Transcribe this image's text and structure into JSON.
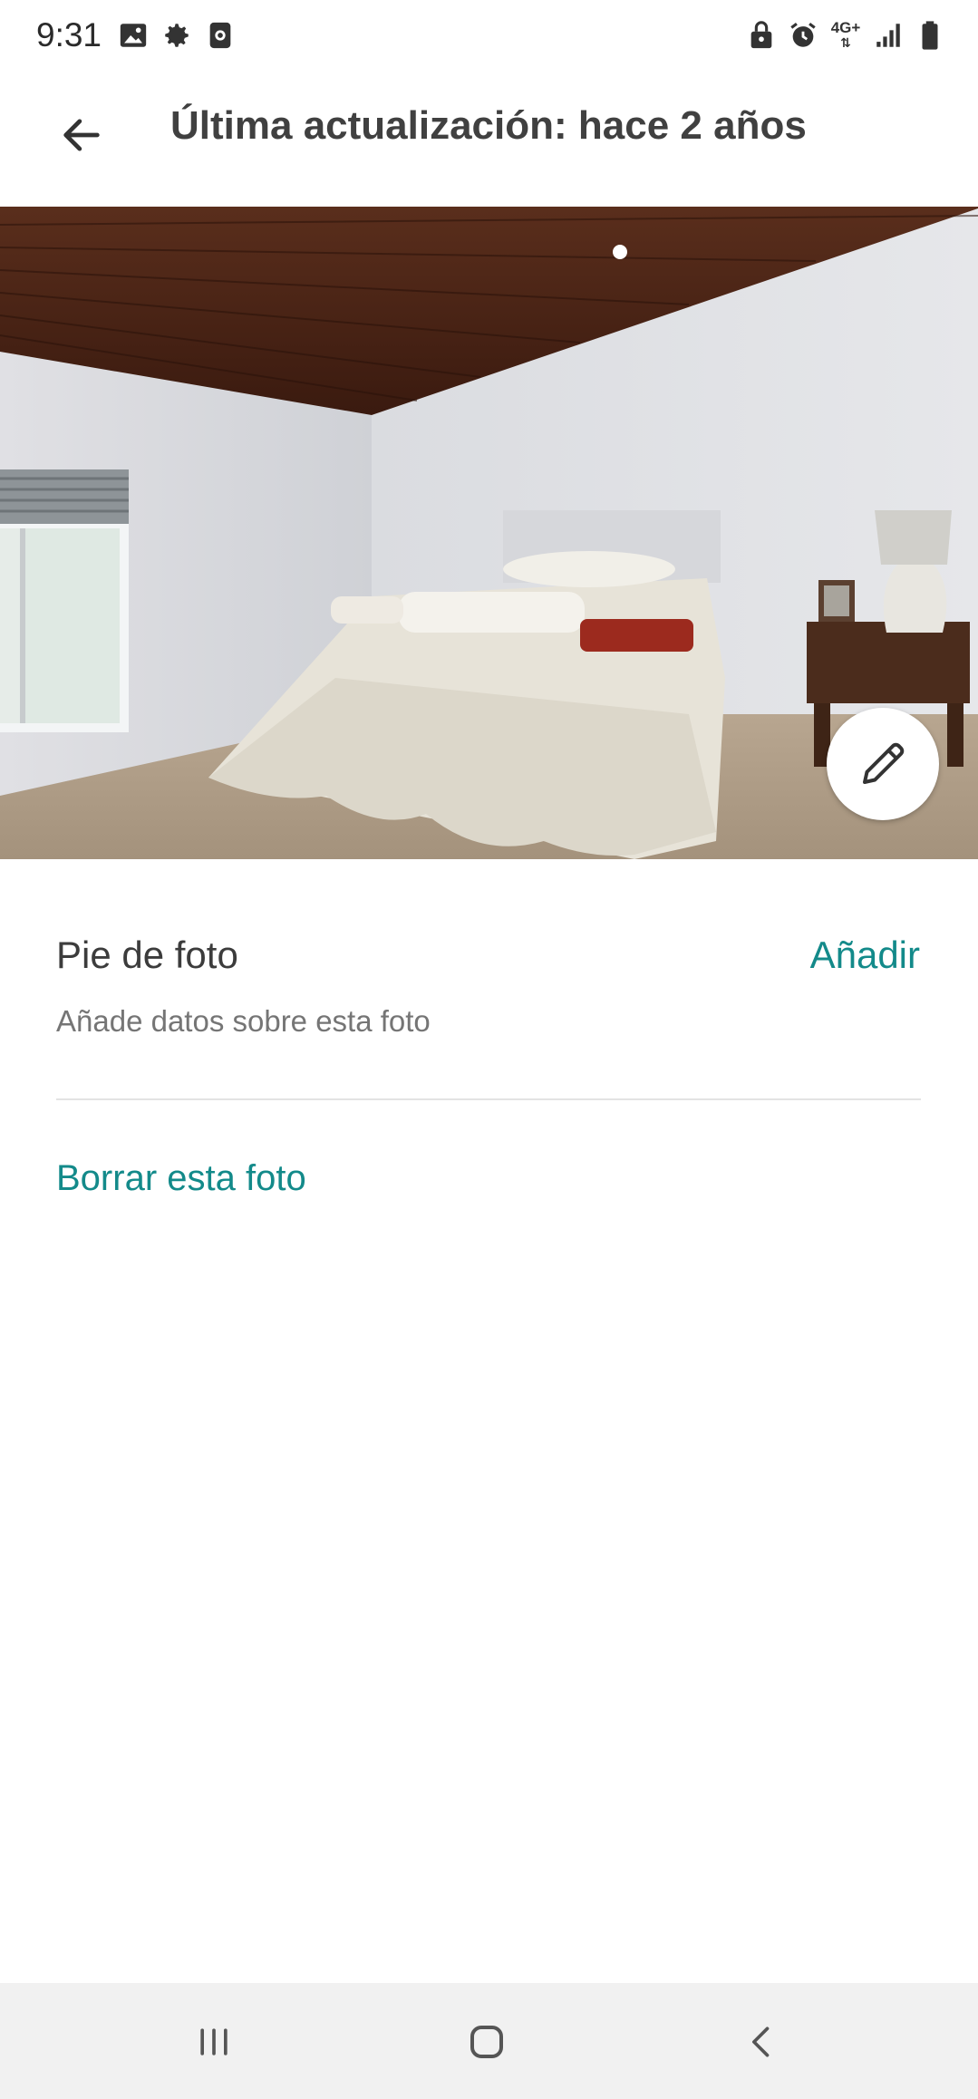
{
  "status_bar": {
    "time": "9:31",
    "left_icons": [
      "image-icon",
      "gear-icon",
      "screen-record-icon"
    ],
    "right_icons": [
      "lock-icon",
      "alarm-icon",
      "network-4g-icon",
      "signal-icon",
      "battery-icon"
    ],
    "network_label": "4G+"
  },
  "header": {
    "back_icon": "arrow-left-icon",
    "title": "Última actualización: hace 2 años"
  },
  "photo": {
    "subject": "bedroom",
    "edit_icon": "pencil-icon"
  },
  "caption": {
    "title": "Pie de foto",
    "action_label": "Añadir",
    "hint": "Añade datos sobre esta foto"
  },
  "actions": {
    "delete_label": "Borrar esta foto"
  },
  "colors": {
    "accent": "#138a8a",
    "nav_bg": "#f1f1f1"
  },
  "nav_bar": {
    "buttons": [
      "recents-icon",
      "home-icon",
      "back-chevron-icon"
    ]
  }
}
